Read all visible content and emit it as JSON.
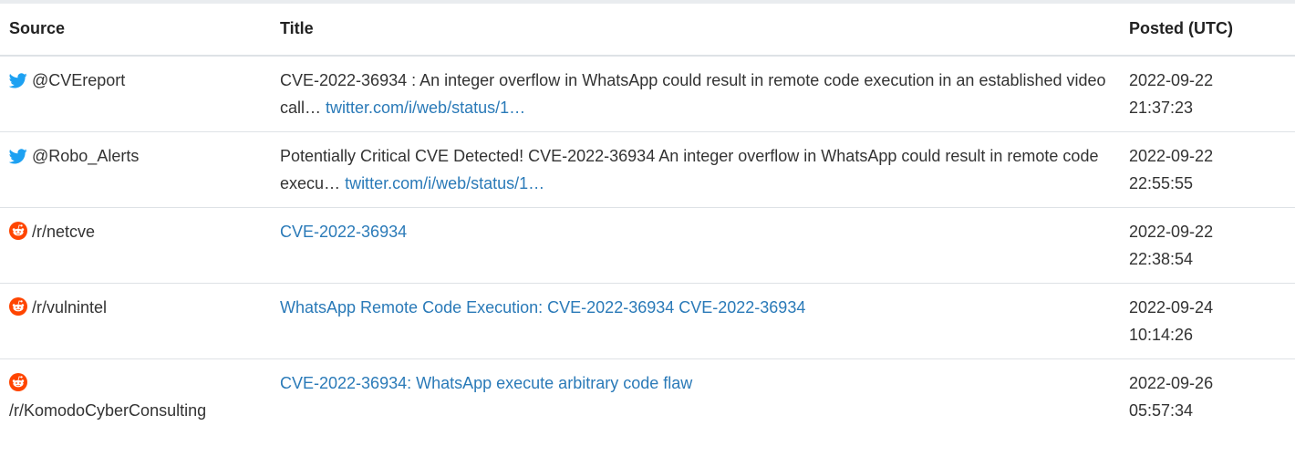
{
  "table": {
    "headers": {
      "source": "Source",
      "title": "Title",
      "posted": "Posted (UTC)"
    },
    "rows": [
      {
        "source_icon": "twitter-icon",
        "source": "@CVEreport",
        "title_text": "CVE-2022-36934 : An integer overflow in WhatsApp could result in remote code execution in an established video call…",
        "title_link": "twitter.com/i/web/status/1…",
        "posted_date": "2022-09-22",
        "posted_time": "21:37:23"
      },
      {
        "source_icon": "twitter-icon",
        "source": "@Robo_Alerts",
        "title_text": "Potentially Critical CVE Detected! CVE-2022-36934 An integer overflow in WhatsApp could result in remote code execu…",
        "title_link": "twitter.com/i/web/status/1…",
        "posted_date": "2022-09-22",
        "posted_time": "22:55:55"
      },
      {
        "source_icon": "reddit-icon",
        "source": "/r/netcve",
        "title_text": "",
        "title_link": "CVE-2022-36934",
        "posted_date": "2022-09-22",
        "posted_time": "22:38:54"
      },
      {
        "source_icon": "reddit-icon",
        "source": "/r/vulnintel",
        "title_text": "",
        "title_link": "WhatsApp Remote Code Execution: CVE-2022-36934 CVE-2022-36934",
        "posted_date": "2022-09-24",
        "posted_time": "10:14:26"
      },
      {
        "source_icon": "reddit-icon",
        "source": "/r/KomodoCyberConsulting",
        "title_text": "",
        "title_link": "CVE-2022-36934: WhatsApp execute arbitrary code flaw",
        "posted_date": "2022-09-26",
        "posted_time": "05:57:34"
      }
    ]
  },
  "colors": {
    "link": "#2a7ab8",
    "twitter": "#1da1f2",
    "reddit": "#ff4500",
    "text": "#333333",
    "border": "#dee2e6"
  }
}
